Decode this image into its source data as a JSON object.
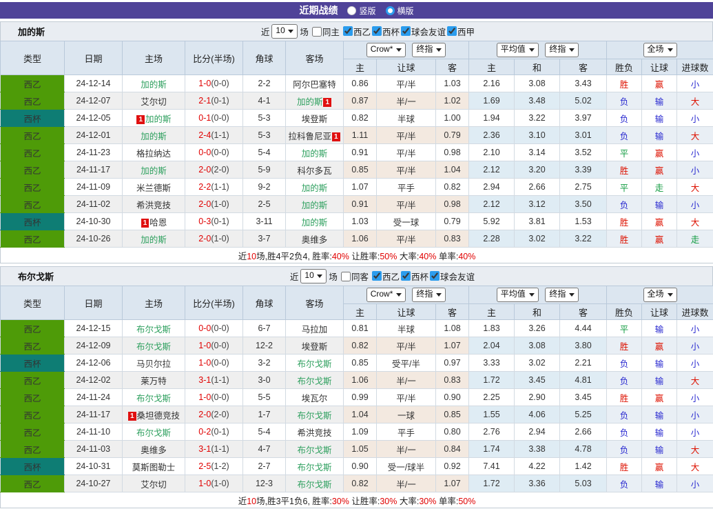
{
  "colors": {
    "titlebar": "#4f4398",
    "liga2": "#4e9b08",
    "cup": "#0e7d74",
    "team": "#2fa05f",
    "red": "#dd1100",
    "blue": "#2a2ad0",
    "green": "#0e9a3e",
    "score": "#e00000",
    "sumred": "#e00000",
    "accent": "#2b9ced",
    "badge": "#e01010"
  },
  "titlebar": {
    "title": "近期战绩",
    "radios": [
      {
        "label": "竖版",
        "checked": false
      },
      {
        "label": "横版",
        "checked": true
      }
    ]
  },
  "sections": [
    {
      "team": "加的斯",
      "filters": {
        "near": "近",
        "count": "10",
        "unit": "场",
        "same": "同主",
        "sameChecked": false,
        "leagues": [
          {
            "label": "西乙",
            "checked": true
          },
          {
            "label": "西杯",
            "checked": true
          },
          {
            "label": "球会友谊",
            "checked": true
          },
          {
            "label": "西甲",
            "checked": true
          }
        ]
      },
      "header": {
        "main": [
          "类型",
          "日期",
          "主场",
          "比分(半场)",
          "角球",
          "客场"
        ],
        "g1a": "Crow*",
        "g1b": "终指",
        "g2a": "平均值",
        "g2b": "终指",
        "g3": "全场",
        "sub": [
          "主",
          "让球",
          "客",
          "主",
          "和",
          "客",
          "胜负",
          "让球",
          "进球数"
        ]
      },
      "rows": [
        {
          "league": "西乙",
          "lt": "liga2",
          "date": "24-12-14",
          "home": {
            "name": "加的斯",
            "hl": true
          },
          "ft": "1-0",
          "ht": "(0-0)",
          "corner": "2-2",
          "away": {
            "name": "阿尔巴塞特"
          },
          "odds": [
            "0.86",
            "平/半",
            "1.03"
          ],
          "avg": [
            "2.16",
            "3.08",
            "3.43"
          ],
          "res": [
            [
              "胜",
              "r"
            ],
            [
              "赢",
              "r"
            ],
            [
              "小",
              "b"
            ]
          ]
        },
        {
          "league": "西乙",
          "lt": "liga2",
          "date": "24-12-07",
          "home": {
            "name": "艾尔切"
          },
          "ft": "2-1",
          "ht": "(0-1)",
          "corner": "4-1",
          "away": {
            "name": "加的斯",
            "hl": true,
            "post": "1"
          },
          "odds": [
            "0.87",
            "半/一",
            "1.02"
          ],
          "avg": [
            "1.69",
            "3.48",
            "5.02"
          ],
          "res": [
            [
              "负",
              "b"
            ],
            [
              "输",
              "b"
            ],
            [
              "大",
              "r"
            ]
          ]
        },
        {
          "league": "西杯",
          "lt": "cup",
          "date": "24-12-05",
          "home": {
            "name": "加的斯",
            "hl": true,
            "pre": "1"
          },
          "ft": "0-1",
          "ht": "(0-0)",
          "corner": "5-3",
          "away": {
            "name": "埃登斯"
          },
          "odds": [
            "0.82",
            "半球",
            "1.00"
          ],
          "avg": [
            "1.94",
            "3.22",
            "3.97"
          ],
          "res": [
            [
              "负",
              "b"
            ],
            [
              "输",
              "b"
            ],
            [
              "小",
              "b"
            ]
          ]
        },
        {
          "league": "西乙",
          "lt": "liga2",
          "date": "24-12-01",
          "home": {
            "name": "加的斯",
            "hl": true
          },
          "ft": "2-4",
          "ht": "(1-1)",
          "corner": "5-3",
          "away": {
            "name": "拉科鲁尼亚",
            "post": "1"
          },
          "odds": [
            "1.11",
            "平/半",
            "0.79"
          ],
          "avg": [
            "2.36",
            "3.10",
            "3.01"
          ],
          "res": [
            [
              "负",
              "b"
            ],
            [
              "输",
              "b"
            ],
            [
              "大",
              "r"
            ]
          ]
        },
        {
          "league": "西乙",
          "lt": "liga2",
          "date": "24-11-23",
          "home": {
            "name": "格拉纳达"
          },
          "ft": "0-0",
          "ht": "(0-0)",
          "corner": "5-4",
          "away": {
            "name": "加的斯",
            "hl": true
          },
          "odds": [
            "0.91",
            "平/半",
            "0.98"
          ],
          "avg": [
            "2.10",
            "3.14",
            "3.52"
          ],
          "res": [
            [
              "平",
              "g"
            ],
            [
              "赢",
              "r"
            ],
            [
              "小",
              "b"
            ]
          ]
        },
        {
          "league": "西乙",
          "lt": "liga2",
          "date": "24-11-17",
          "home": {
            "name": "加的斯",
            "hl": true
          },
          "ft": "2-0",
          "ht": "(2-0)",
          "corner": "5-9",
          "away": {
            "name": "科尔多瓦"
          },
          "odds": [
            "0.85",
            "平/半",
            "1.04"
          ],
          "avg": [
            "2.12",
            "3.20",
            "3.39"
          ],
          "res": [
            [
              "胜",
              "r"
            ],
            [
              "赢",
              "r"
            ],
            [
              "小",
              "b"
            ]
          ]
        },
        {
          "league": "西乙",
          "lt": "liga2",
          "date": "24-11-09",
          "home": {
            "name": "米兰德斯"
          },
          "ft": "2-2",
          "ht": "(1-1)",
          "corner": "9-2",
          "away": {
            "name": "加的斯",
            "hl": true
          },
          "odds": [
            "1.07",
            "平手",
            "0.82"
          ],
          "avg": [
            "2.94",
            "2.66",
            "2.75"
          ],
          "res": [
            [
              "平",
              "g"
            ],
            [
              "走",
              "g"
            ],
            [
              "大",
              "r"
            ]
          ]
        },
        {
          "league": "西乙",
          "lt": "liga2",
          "date": "24-11-02",
          "home": {
            "name": "希洪竞技"
          },
          "ft": "2-0",
          "ht": "(1-0)",
          "corner": "2-5",
          "away": {
            "name": "加的斯",
            "hl": true
          },
          "odds": [
            "0.91",
            "平/半",
            "0.98"
          ],
          "avg": [
            "2.12",
            "3.12",
            "3.50"
          ],
          "res": [
            [
              "负",
              "b"
            ],
            [
              "输",
              "b"
            ],
            [
              "小",
              "b"
            ]
          ]
        },
        {
          "league": "西杯",
          "lt": "cup",
          "date": "24-10-30",
          "home": {
            "name": "哈恩",
            "pre": "1"
          },
          "ft": "0-3",
          "ht": "(0-1)",
          "corner": "3-11",
          "away": {
            "name": "加的斯",
            "hl": true
          },
          "odds": [
            "1.03",
            "受一球",
            "0.79"
          ],
          "avg": [
            "5.92",
            "3.81",
            "1.53"
          ],
          "res": [
            [
              "胜",
              "r"
            ],
            [
              "赢",
              "r"
            ],
            [
              "大",
              "r"
            ]
          ]
        },
        {
          "league": "西乙",
          "lt": "liga2",
          "date": "24-10-26",
          "home": {
            "name": "加的斯",
            "hl": true
          },
          "ft": "2-0",
          "ht": "(1-0)",
          "corner": "3-7",
          "away": {
            "name": "奥维多"
          },
          "odds": [
            "1.06",
            "平/半",
            "0.83"
          ],
          "avg": [
            "2.28",
            "3.02",
            "3.22"
          ],
          "res": [
            [
              "胜",
              "r"
            ],
            [
              "赢",
              "r"
            ],
            [
              "走",
              "g"
            ]
          ]
        }
      ],
      "summary": [
        {
          "t": "近"
        },
        {
          "t": "10",
          "red": true
        },
        {
          "t": "场,胜4平2负4, 胜率:"
        },
        {
          "t": "40%",
          "red": true
        },
        {
          "t": " 让胜率:"
        },
        {
          "t": "50%",
          "red": true
        },
        {
          "t": " 大率:"
        },
        {
          "t": "40%",
          "red": true
        },
        {
          "t": " 单率:"
        },
        {
          "t": "40%",
          "red": true
        }
      ]
    },
    {
      "team": "布尔戈斯",
      "filters": {
        "near": "近",
        "count": "10",
        "unit": "场",
        "same": "同客",
        "sameChecked": false,
        "leagues": [
          {
            "label": "西乙",
            "checked": true
          },
          {
            "label": "西杯",
            "checked": true
          },
          {
            "label": "球会友谊",
            "checked": true
          }
        ]
      },
      "header": {
        "main": [
          "类型",
          "日期",
          "主场",
          "比分(半场)",
          "角球",
          "客场"
        ],
        "g1a": "Crow*",
        "g1b": "终指",
        "g2a": "平均值",
        "g2b": "终指",
        "g3": "全场",
        "sub": [
          "主",
          "让球",
          "客",
          "主",
          "和",
          "客",
          "胜负",
          "让球",
          "进球数"
        ]
      },
      "rows": [
        {
          "league": "西乙",
          "lt": "liga2",
          "date": "24-12-15",
          "home": {
            "name": "布尔戈斯",
            "hl": true
          },
          "ft": "0-0",
          "ht": "(0-0)",
          "corner": "6-7",
          "away": {
            "name": "马拉加"
          },
          "odds": [
            "0.81",
            "半球",
            "1.08"
          ],
          "avg": [
            "1.83",
            "3.26",
            "4.44"
          ],
          "res": [
            [
              "平",
              "g"
            ],
            [
              "输",
              "b"
            ],
            [
              "小",
              "b"
            ]
          ]
        },
        {
          "league": "西乙",
          "lt": "liga2",
          "date": "24-12-09",
          "home": {
            "name": "布尔戈斯",
            "hl": true
          },
          "ft": "1-0",
          "ht": "(0-0)",
          "corner": "12-2",
          "away": {
            "name": "埃登斯"
          },
          "odds": [
            "0.82",
            "平/半",
            "1.07"
          ],
          "avg": [
            "2.04",
            "3.08",
            "3.80"
          ],
          "res": [
            [
              "胜",
              "r"
            ],
            [
              "赢",
              "r"
            ],
            [
              "小",
              "b"
            ]
          ]
        },
        {
          "league": "西杯",
          "lt": "cup",
          "date": "24-12-06",
          "home": {
            "name": "马贝尔拉"
          },
          "ft": "1-0",
          "ht": "(0-0)",
          "corner": "3-2",
          "away": {
            "name": "布尔戈斯",
            "hl": true
          },
          "odds": [
            "0.85",
            "受平/半",
            "0.97"
          ],
          "avg": [
            "3.33",
            "3.02",
            "2.21"
          ],
          "res": [
            [
              "负",
              "b"
            ],
            [
              "输",
              "b"
            ],
            [
              "小",
              "b"
            ]
          ]
        },
        {
          "league": "西乙",
          "lt": "liga2",
          "date": "24-12-02",
          "home": {
            "name": "莱万特"
          },
          "ft": "3-1",
          "ht": "(1-1)",
          "corner": "3-0",
          "away": {
            "name": "布尔戈斯",
            "hl": true
          },
          "odds": [
            "1.06",
            "半/一",
            "0.83"
          ],
          "avg": [
            "1.72",
            "3.45",
            "4.81"
          ],
          "res": [
            [
              "负",
              "b"
            ],
            [
              "输",
              "b"
            ],
            [
              "大",
              "r"
            ]
          ]
        },
        {
          "league": "西乙",
          "lt": "liga2",
          "date": "24-11-24",
          "home": {
            "name": "布尔戈斯",
            "hl": true
          },
          "ft": "1-0",
          "ht": "(0-0)",
          "corner": "5-5",
          "away": {
            "name": "埃瓦尔"
          },
          "odds": [
            "0.99",
            "平/半",
            "0.90"
          ],
          "avg": [
            "2.25",
            "2.90",
            "3.45"
          ],
          "res": [
            [
              "胜",
              "r"
            ],
            [
              "赢",
              "r"
            ],
            [
              "小",
              "b"
            ]
          ]
        },
        {
          "league": "西乙",
          "lt": "liga2",
          "date": "24-11-17",
          "home": {
            "name": "桑坦德竞技",
            "pre": "1"
          },
          "ft": "2-0",
          "ht": "(2-0)",
          "corner": "1-7",
          "away": {
            "name": "布尔戈斯",
            "hl": true
          },
          "odds": [
            "1.04",
            "一球",
            "0.85"
          ],
          "avg": [
            "1.55",
            "4.06",
            "5.25"
          ],
          "res": [
            [
              "负",
              "b"
            ],
            [
              "输",
              "b"
            ],
            [
              "小",
              "b"
            ]
          ]
        },
        {
          "league": "西乙",
          "lt": "liga2",
          "date": "24-11-10",
          "home": {
            "name": "布尔戈斯",
            "hl": true
          },
          "ft": "0-2",
          "ht": "(0-1)",
          "corner": "5-4",
          "away": {
            "name": "希洪竞技"
          },
          "odds": [
            "1.09",
            "平手",
            "0.80"
          ],
          "avg": [
            "2.76",
            "2.94",
            "2.66"
          ],
          "res": [
            [
              "负",
              "b"
            ],
            [
              "输",
              "b"
            ],
            [
              "小",
              "b"
            ]
          ]
        },
        {
          "league": "西乙",
          "lt": "liga2",
          "date": "24-11-03",
          "home": {
            "name": "奥维多"
          },
          "ft": "3-1",
          "ht": "(1-1)",
          "corner": "4-7",
          "away": {
            "name": "布尔戈斯",
            "hl": true
          },
          "odds": [
            "1.05",
            "半/一",
            "0.84"
          ],
          "avg": [
            "1.74",
            "3.38",
            "4.78"
          ],
          "res": [
            [
              "负",
              "b"
            ],
            [
              "输",
              "b"
            ],
            [
              "大",
              "r"
            ]
          ]
        },
        {
          "league": "西杯",
          "lt": "cup",
          "date": "24-10-31",
          "home": {
            "name": "莫斯图勒士"
          },
          "ft": "2-5",
          "ht": "(1-2)",
          "corner": "2-7",
          "away": {
            "name": "布尔戈斯",
            "hl": true
          },
          "odds": [
            "0.90",
            "受一/球半",
            "0.92"
          ],
          "avg": [
            "7.41",
            "4.22",
            "1.42"
          ],
          "res": [
            [
              "胜",
              "r"
            ],
            [
              "赢",
              "r"
            ],
            [
              "大",
              "r"
            ]
          ]
        },
        {
          "league": "西乙",
          "lt": "liga2",
          "date": "24-10-27",
          "home": {
            "name": "艾尔切"
          },
          "ft": "1-0",
          "ht": "(1-0)",
          "corner": "12-3",
          "away": {
            "name": "布尔戈斯",
            "hl": true
          },
          "odds": [
            "0.82",
            "半/一",
            "1.07"
          ],
          "avg": [
            "1.72",
            "3.36",
            "5.03"
          ],
          "res": [
            [
              "负",
              "b"
            ],
            [
              "输",
              "b"
            ],
            [
              "小",
              "b"
            ]
          ]
        }
      ],
      "summary": [
        {
          "t": "近"
        },
        {
          "t": "10",
          "red": true
        },
        {
          "t": "场,胜3平1负6, 胜率:"
        },
        {
          "t": "30%",
          "red": true
        },
        {
          "t": " 让胜率:"
        },
        {
          "t": "30%",
          "red": true
        },
        {
          "t": " 大率:"
        },
        {
          "t": "30%",
          "red": true
        },
        {
          "t": " 单率:"
        },
        {
          "t": "50%",
          "red": true
        }
      ]
    }
  ]
}
